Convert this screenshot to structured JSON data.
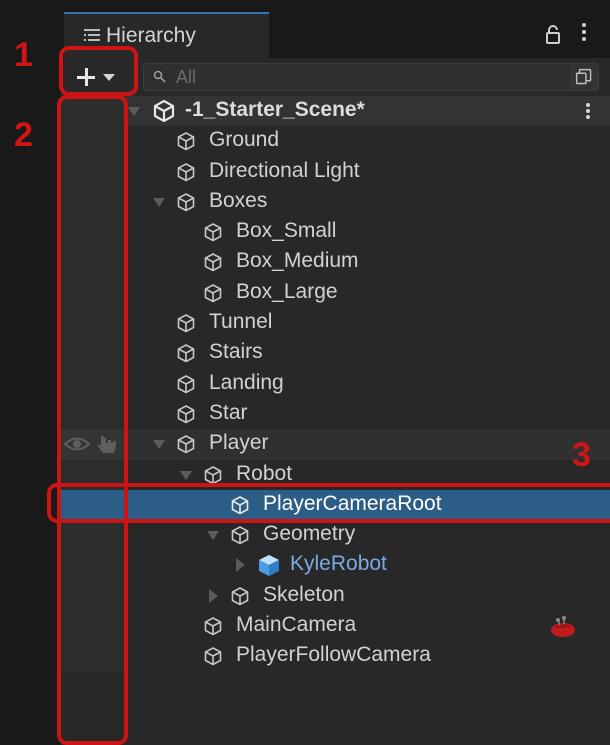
{
  "panel": {
    "tab_title": "Hierarchy",
    "tab_icon": "hierarchy-list-icon",
    "lock_icon": "lock-icon",
    "menu_icon": "kebab-menu-icon"
  },
  "toolbar": {
    "add_icon": "plus-icon",
    "dropdown_icon": "caret-down-icon",
    "search_placeholder": "All",
    "search_icon": "search-icon",
    "search_mode_icon": "search-mode-icon"
  },
  "tree": {
    "scene": "-1_Starter_Scene*",
    "items": [
      {
        "label": "Ground"
      },
      {
        "label": "Directional Light"
      },
      {
        "label": "Boxes"
      },
      {
        "label": "Box_Small"
      },
      {
        "label": "Box_Medium"
      },
      {
        "label": "Box_Large"
      },
      {
        "label": "Tunnel"
      },
      {
        "label": "Stairs"
      },
      {
        "label": "Landing"
      },
      {
        "label": "Star"
      },
      {
        "label": "Player"
      },
      {
        "label": "Robot"
      },
      {
        "label": "PlayerCameraRoot"
      },
      {
        "label": "Geometry"
      },
      {
        "label": "KyleRobot"
      },
      {
        "label": "Skeleton"
      },
      {
        "label": "MainCamera"
      },
      {
        "label": "PlayerFollowCamera"
      }
    ]
  },
  "annotations": {
    "one": "1",
    "two": "2",
    "three": "3"
  },
  "colors": {
    "selection": "#2c5d87",
    "annotation": "#cc1414",
    "prefab_text": "#7ba9e3",
    "panel_bg": "#282828"
  }
}
